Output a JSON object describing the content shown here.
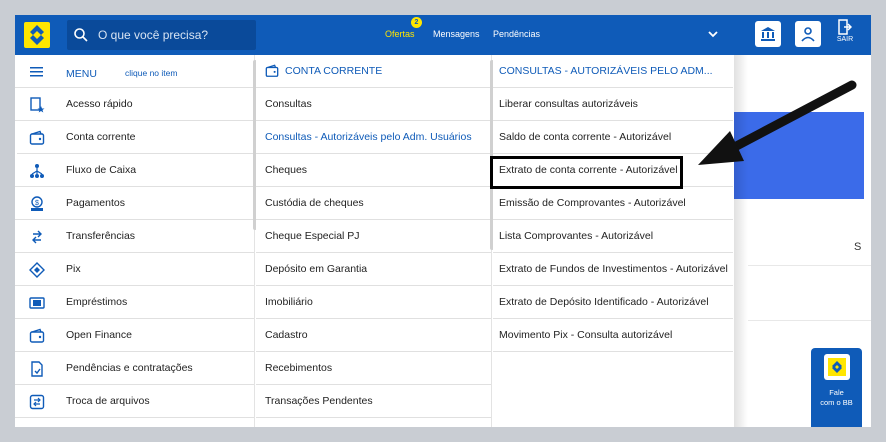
{
  "header": {
    "search_placeholder": "O que você precisa?",
    "ofertas": "Ofertas",
    "ofertas_badge": "2",
    "mensagens": "Mensagens",
    "pendencias": "Pendências",
    "sair": "SAIR"
  },
  "menu": {
    "title": "MENU",
    "hint": "clique no item",
    "items": [
      {
        "label": "Acesso rápido",
        "icon": "quick-access-icon"
      },
      {
        "label": "Conta corrente",
        "icon": "wallet-icon"
      },
      {
        "label": "Fluxo de Caixa",
        "icon": "cash-flow-icon"
      },
      {
        "label": "Pagamentos",
        "icon": "payments-icon"
      },
      {
        "label": "Transferências",
        "icon": "transfer-icon"
      },
      {
        "label": "Pix",
        "icon": "pix-icon"
      },
      {
        "label": "Empréstimos",
        "icon": "loans-icon"
      },
      {
        "label": "Open Finance",
        "icon": "open-finance-icon"
      },
      {
        "label": "Pendências e contratações",
        "icon": "pending-icon"
      },
      {
        "label": "Troca de arquivos",
        "icon": "file-exchange-icon"
      }
    ]
  },
  "conta_corrente": {
    "title": "CONTA CORRENTE",
    "items": [
      "Consultas",
      "Consultas - Autorizáveis pelo Adm. Usuários",
      "Cheques",
      "Custódia de cheques",
      "Cheque Especial PJ",
      "Depósito em Garantia",
      "Imobiliário",
      "Cadastro",
      "Recebimentos",
      "Transações Pendentes"
    ]
  },
  "consultas_autorizaveis": {
    "title": "CONSULTAS - AUTORIZÁVEIS PELO ADM...",
    "items": [
      "Liberar consultas autorizáveis",
      "Saldo de conta corrente - Autorizável",
      "Extrato de conta corrente - Autorizável",
      "Emissão de Comprovantes - Autorizável",
      "Lista Comprovantes - Autorizável",
      "Extrato de Fundos de Investimentos - Autorizável",
      "Extrato de Depósito Identificado - Autorizável",
      "Movimento Pix - Consulta autorizável"
    ]
  },
  "background": {
    "side_letter": "S"
  },
  "fale": {
    "line1": "Fale",
    "line2": "com o BB"
  },
  "colors": {
    "brand_blue": "#0F5BB8",
    "brand_yellow": "#FFE600",
    "accent_block": "#3B6BE9"
  }
}
